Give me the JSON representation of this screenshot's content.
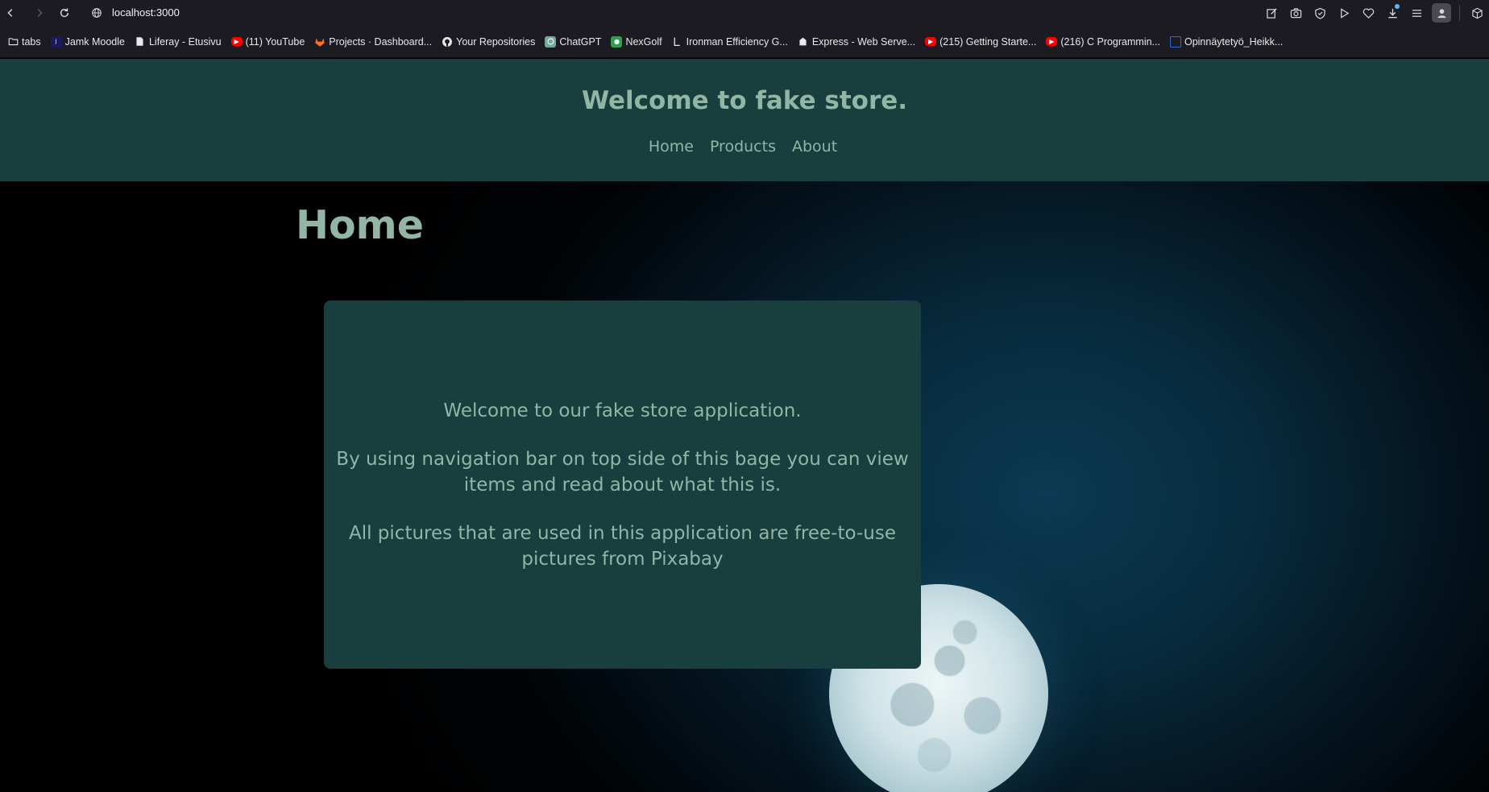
{
  "browser": {
    "url": "localhost:3000",
    "icons": {
      "back": "back-arrow-icon",
      "forward": "forward-arrow-icon",
      "reload": "reload-icon",
      "site": "globe-icon",
      "right": [
        "edit-icon",
        "camera-icon",
        "shield-icon",
        "play-icon",
        "heart-icon",
        "download-icon",
        "menu-icon",
        "profile-icon",
        "extensions-icon"
      ]
    }
  },
  "bookmarks": [
    {
      "label": "tabs",
      "icon": "folder-icon",
      "color": "#e8e8ec"
    },
    {
      "label": "Jamk Moodle",
      "icon": "jamk-icon",
      "color": "#1a1a5e"
    },
    {
      "label": "Liferay - Etusivu",
      "icon": "page-icon",
      "color": "#e8e8ec"
    },
    {
      "label": "(11) YouTube",
      "icon": "youtube-icon",
      "color": "#ff0000"
    },
    {
      "label": "Projects · Dashboard...",
      "icon": "gitlab-icon",
      "color": "#fc6d26"
    },
    {
      "label": "Your Repositories",
      "icon": "github-icon",
      "color": "#e8e8ec"
    },
    {
      "label": "ChatGPT",
      "icon": "chatgpt-icon",
      "color": "#74aa9c"
    },
    {
      "label": "NexGolf",
      "icon": "nexgolf-icon",
      "color": "#2e9e4f"
    },
    {
      "label": "Ironman Efficiency G...",
      "icon": "ironman-icon",
      "color": "#e8e8ec"
    },
    {
      "label": "Express - Web Serve...",
      "icon": "express-icon",
      "color": "#e8e8ec"
    },
    {
      "label": "(215) Getting Starte...",
      "icon": "youtube-icon",
      "color": "#ff0000"
    },
    {
      "label": "(216) C Programmin...",
      "icon": "youtube-icon",
      "color": "#ff0000"
    },
    {
      "label": "Opinnäytetyö_Heikk...",
      "icon": "doc-icon",
      "color": "#2b6cd4"
    }
  ],
  "site": {
    "title": "Welcome to fake store.",
    "nav": [
      "Home",
      "Products",
      "About"
    ],
    "heading": "Home",
    "card": {
      "p1": "Welcome to our fake store application.",
      "p2": "By using navigation bar on top side of this bage you can view items and read about what this is.",
      "p3": "All pictures that are used in this application are free-to-use pictures from Pixabay"
    }
  },
  "colors": {
    "header_bg": "#183e3e",
    "text_accent": "#93b5a4",
    "chrome_bg": "#1c1b22"
  }
}
